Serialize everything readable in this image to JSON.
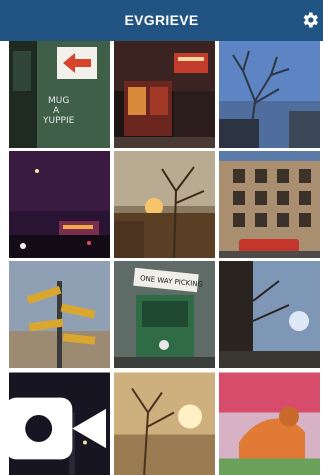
{
  "header": {
    "title": "EVGRIEVE",
    "settings_icon": "gear-icon",
    "bar_color": "#225483"
  },
  "photos": [
    {
      "subject": "street-door-with-arrow-graffiti"
    },
    {
      "subject": "storefront-neon-night"
    },
    {
      "subject": "tree-branches-blue-sky"
    },
    {
      "subject": "night-street-purple-sky"
    },
    {
      "subject": "autumn-tree-sunset"
    },
    {
      "subject": "brick-building-red-car"
    },
    {
      "subject": "street-sign-post"
    },
    {
      "subject": "green-newspaper-box"
    },
    {
      "subject": "tree-silhouette-sky"
    },
    {
      "subject": "dark-night-street",
      "badge_icon": "video-camera-icon"
    },
    {
      "subject": "autumn-park-path"
    },
    {
      "subject": "mural-animal-painting"
    }
  ],
  "grid_texts": {
    "door_arrow": "←",
    "wall_graffiti_1": "MUG",
    "wall_graffiti_2": "A",
    "wall_graffiti_3": "YUPPIE",
    "newsbox_label": "ONE WAY PICKING"
  }
}
